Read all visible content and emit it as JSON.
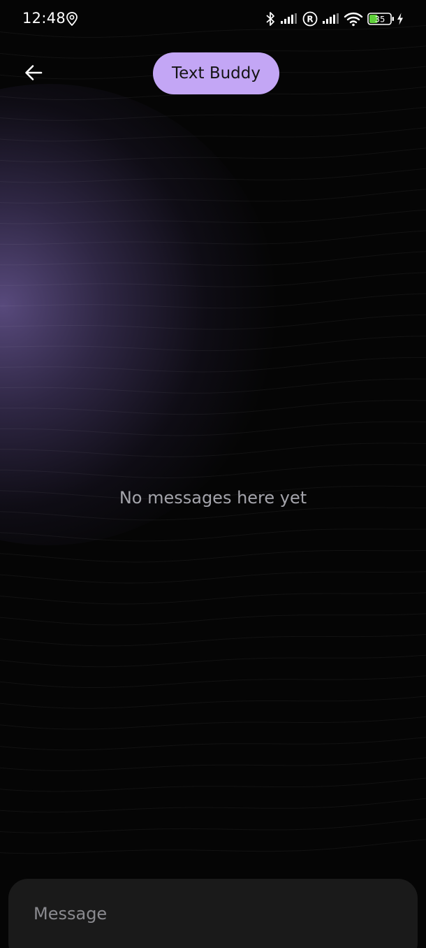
{
  "status_bar": {
    "time": "12:48",
    "battery_level": "35",
    "icons": [
      "location-icon",
      "bluetooth-icon",
      "signal-icon",
      "roaming-icon",
      "signal-icon",
      "wifi-icon",
      "battery-icon",
      "charging-icon"
    ]
  },
  "header": {
    "back_icon": "arrow-left-icon",
    "title": "Text Buddy"
  },
  "conversation": {
    "empty_text": "No messages here yet"
  },
  "composer": {
    "placeholder": "Message",
    "value": ""
  },
  "colors": {
    "background": "#050505",
    "accent": "#c3a6f5",
    "glow": "#7864aa",
    "composer": "#1a1a1a"
  }
}
